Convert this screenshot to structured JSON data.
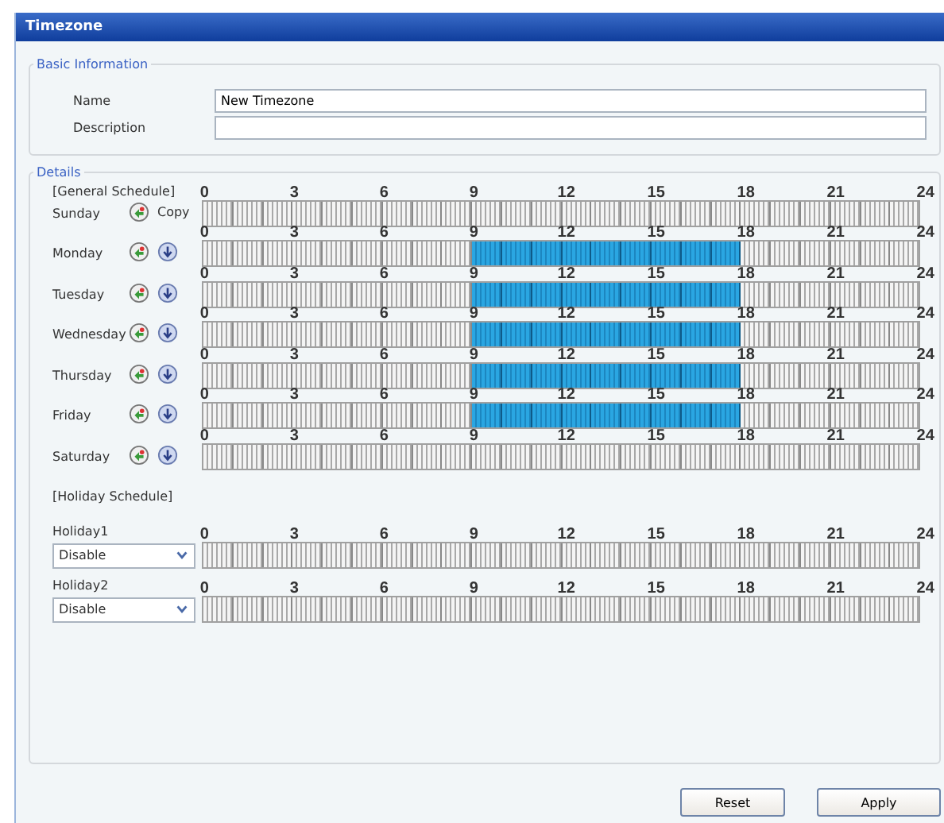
{
  "window": {
    "title": "Timezone"
  },
  "basic_information": {
    "legend": "Basic Information",
    "fields": [
      {
        "label": "Name",
        "value": "New Timezone"
      },
      {
        "label": "Description"
      }
    ]
  },
  "details": {
    "legend": "Details",
    "general_heading": "[General Schedule]",
    "holiday_heading": "[Holiday Schedule]"
  },
  "general_schedule": [
    {
      "day": "Sunday",
      "kind": "source",
      "copy_label": "Copy",
      "scale": [
        "0",
        "3",
        "6",
        "9",
        "12",
        "15",
        "18",
        "21",
        "24"
      ],
      "hours": [
        false,
        false,
        false,
        false,
        false,
        false,
        false,
        false,
        false,
        false,
        false,
        false,
        false,
        false,
        false,
        false,
        false,
        false,
        false,
        false,
        false,
        false,
        false,
        false
      ]
    },
    {
      "day": "Monday",
      "kind": "target",
      "scale": [
        "0",
        "3",
        "6",
        "9",
        "12",
        "15",
        "18",
        "21",
        "24"
      ],
      "hours": [
        false,
        false,
        false,
        false,
        false,
        false,
        false,
        false,
        false,
        true,
        true,
        true,
        true,
        true,
        true,
        true,
        true,
        true,
        false,
        false,
        false,
        false,
        false,
        false
      ]
    },
    {
      "day": "Tuesday",
      "kind": "target",
      "scale": [
        "0",
        "3",
        "6",
        "9",
        "12",
        "15",
        "18",
        "21",
        "24"
      ],
      "hours": [
        false,
        false,
        false,
        false,
        false,
        false,
        false,
        false,
        false,
        true,
        true,
        true,
        true,
        true,
        true,
        true,
        true,
        true,
        false,
        false,
        false,
        false,
        false,
        false
      ]
    },
    {
      "day": "Wednesday",
      "kind": "target",
      "scale": [
        "0",
        "3",
        "6",
        "9",
        "12",
        "15",
        "18",
        "21",
        "24"
      ],
      "hours": [
        false,
        false,
        false,
        false,
        false,
        false,
        false,
        false,
        false,
        true,
        true,
        true,
        true,
        true,
        true,
        true,
        true,
        true,
        false,
        false,
        false,
        false,
        false,
        false
      ]
    },
    {
      "day": "Thursday",
      "kind": "target",
      "scale": [
        "0",
        "3",
        "6",
        "9",
        "12",
        "15",
        "18",
        "21",
        "24"
      ],
      "hours": [
        false,
        false,
        false,
        false,
        false,
        false,
        false,
        false,
        false,
        true,
        true,
        true,
        true,
        true,
        true,
        true,
        true,
        true,
        false,
        false,
        false,
        false,
        false,
        false
      ]
    },
    {
      "day": "Friday",
      "kind": "target",
      "scale": [
        "0",
        "3",
        "6",
        "9",
        "12",
        "15",
        "18",
        "21",
        "24"
      ],
      "hours": [
        false,
        false,
        false,
        false,
        false,
        false,
        false,
        false,
        false,
        true,
        true,
        true,
        true,
        true,
        true,
        true,
        true,
        true,
        false,
        false,
        false,
        false,
        false,
        false
      ]
    },
    {
      "day": "Saturday",
      "kind": "target",
      "scale": [
        "0",
        "3",
        "6",
        "9",
        "12",
        "15",
        "18",
        "21",
        "24"
      ],
      "hours": [
        false,
        false,
        false,
        false,
        false,
        false,
        false,
        false,
        false,
        false,
        false,
        false,
        false,
        false,
        false,
        false,
        false,
        false,
        false,
        false,
        false,
        false,
        false,
        false
      ]
    }
  ],
  "holiday_schedule": [
    {
      "label": "Holiday1",
      "value": "Disable",
      "scale": [
        "0",
        "3",
        "6",
        "9",
        "12",
        "15",
        "18",
        "21",
        "24"
      ],
      "hours": [
        false,
        false,
        false,
        false,
        false,
        false,
        false,
        false,
        false,
        false,
        false,
        false,
        false,
        false,
        false,
        false,
        false,
        false,
        false,
        false,
        false,
        false,
        false,
        false
      ]
    },
    {
      "label": "Holiday2",
      "value": "Disable",
      "scale": [
        "0",
        "3",
        "6",
        "9",
        "12",
        "15",
        "18",
        "21",
        "24"
      ],
      "hours": [
        false,
        false,
        false,
        false,
        false,
        false,
        false,
        false,
        false,
        false,
        false,
        false,
        false,
        false,
        false,
        false,
        false,
        false,
        false,
        false,
        false,
        false,
        false,
        false
      ]
    }
  ],
  "buttons": [
    "Reset",
    "Apply"
  ]
}
